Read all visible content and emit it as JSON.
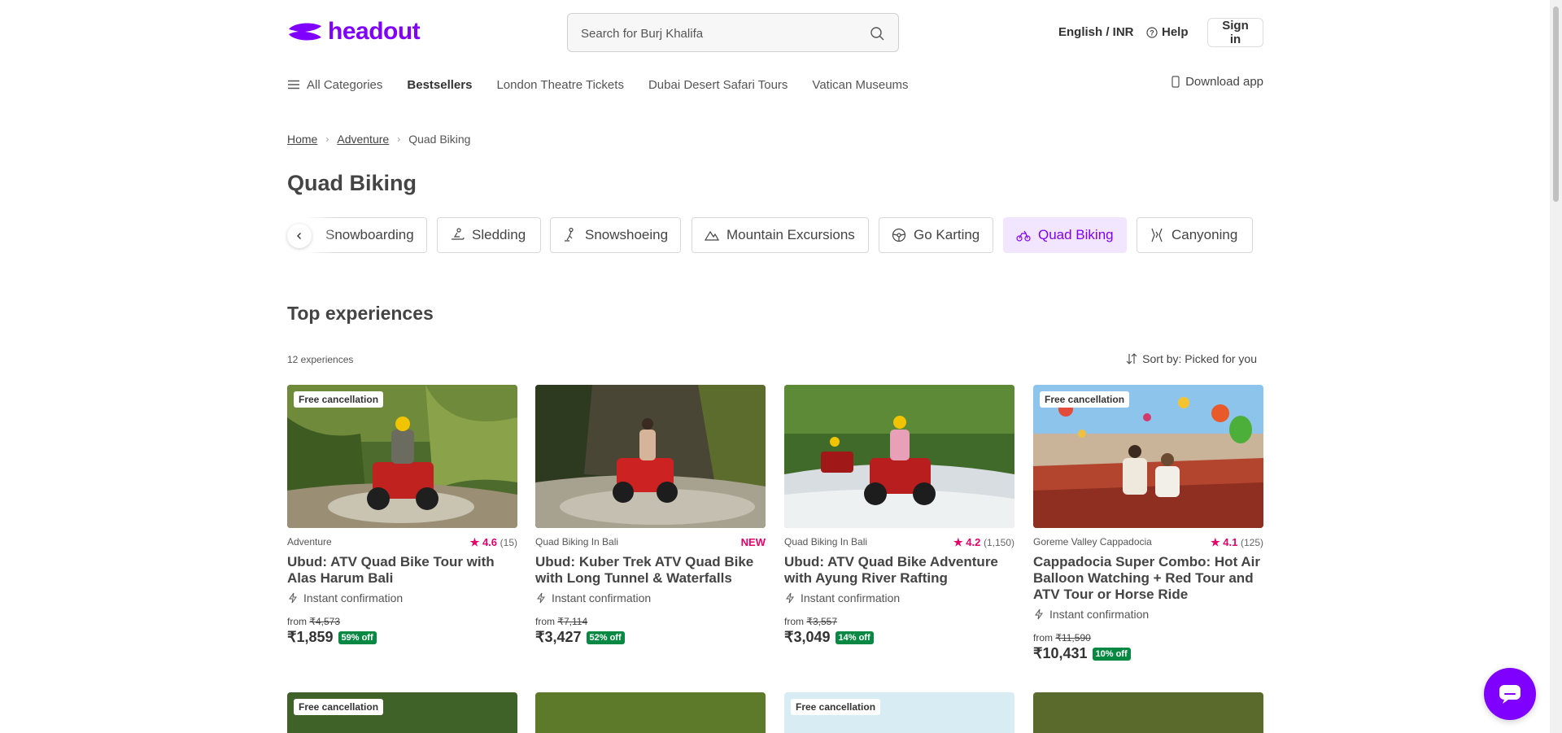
{
  "header": {
    "logo_text": "headout",
    "search_placeholder": "Search for Burj Khalifa",
    "language_currency": "English / INR",
    "help_label": "Help",
    "signin_label": "Sign in"
  },
  "nav": {
    "items": [
      "All Categories",
      "Bestsellers",
      "London Theatre Tickets",
      "Dubai Desert Safari Tours",
      "Vatican Museums"
    ],
    "download_label": "Download app"
  },
  "breadcrumb": [
    "Home",
    "Adventure",
    "Quad Biking"
  ],
  "page_title": "Quad Biking",
  "chips": [
    "Snowboarding",
    "Sledding",
    "Snowshoeing",
    "Mountain Excursions",
    "Go Karting",
    "Quad Biking",
    "Canyoning"
  ],
  "active_chip": "Quad Biking",
  "section": {
    "title": "Top experiences",
    "count": "12 experiences",
    "sort": "Sort by: Picked for you"
  },
  "cards": [
    {
      "badge": "Free cancellation",
      "category": "Adventure",
      "rating": "4.6",
      "rating_count": "(15)",
      "title": "Ubud: ATV Quad Bike Tour with Alas Harum Bali",
      "instant": "Instant confirmation",
      "from_label": "from",
      "old_price": "₹4,573",
      "price": "₹1,859",
      "off": "59% off"
    },
    {
      "badge": "",
      "category": "Quad Biking In Bali",
      "new_label": "NEW",
      "title": "Ubud: Kuber Trek ATV Quad Bike with Long Tunnel & Waterfalls",
      "instant": "Instant confirmation",
      "from_label": "from",
      "old_price": "₹7,114",
      "price": "₹3,427",
      "off": "52% off"
    },
    {
      "badge": "",
      "category": "Quad Biking In Bali",
      "rating": "4.2",
      "rating_count": "(1,150)",
      "title": "Ubud: ATV Quad Bike Adventure with Ayung River Rafting",
      "instant": "Instant confirmation",
      "from_label": "from",
      "old_price": "₹3,557",
      "price": "₹3,049",
      "off": "14% off"
    },
    {
      "badge": "Free cancellation",
      "category": "Goreme Valley Cappadocia",
      "rating": "4.1",
      "rating_count": "(125)",
      "title": "Cappadocia Super Combo: Hot Air Balloon Watching + Red Tour and ATV Tour or Horse Ride",
      "instant": "Instant confirmation",
      "from_label": "from",
      "old_price": "₹11,590",
      "price": "₹10,431",
      "off": "10% off"
    }
  ],
  "second_row_badges": [
    "Free cancellation",
    "",
    "Free cancellation",
    ""
  ],
  "colors": {
    "brand": "#8000ff",
    "rating": "#e5006a",
    "discount": "#088943"
  }
}
